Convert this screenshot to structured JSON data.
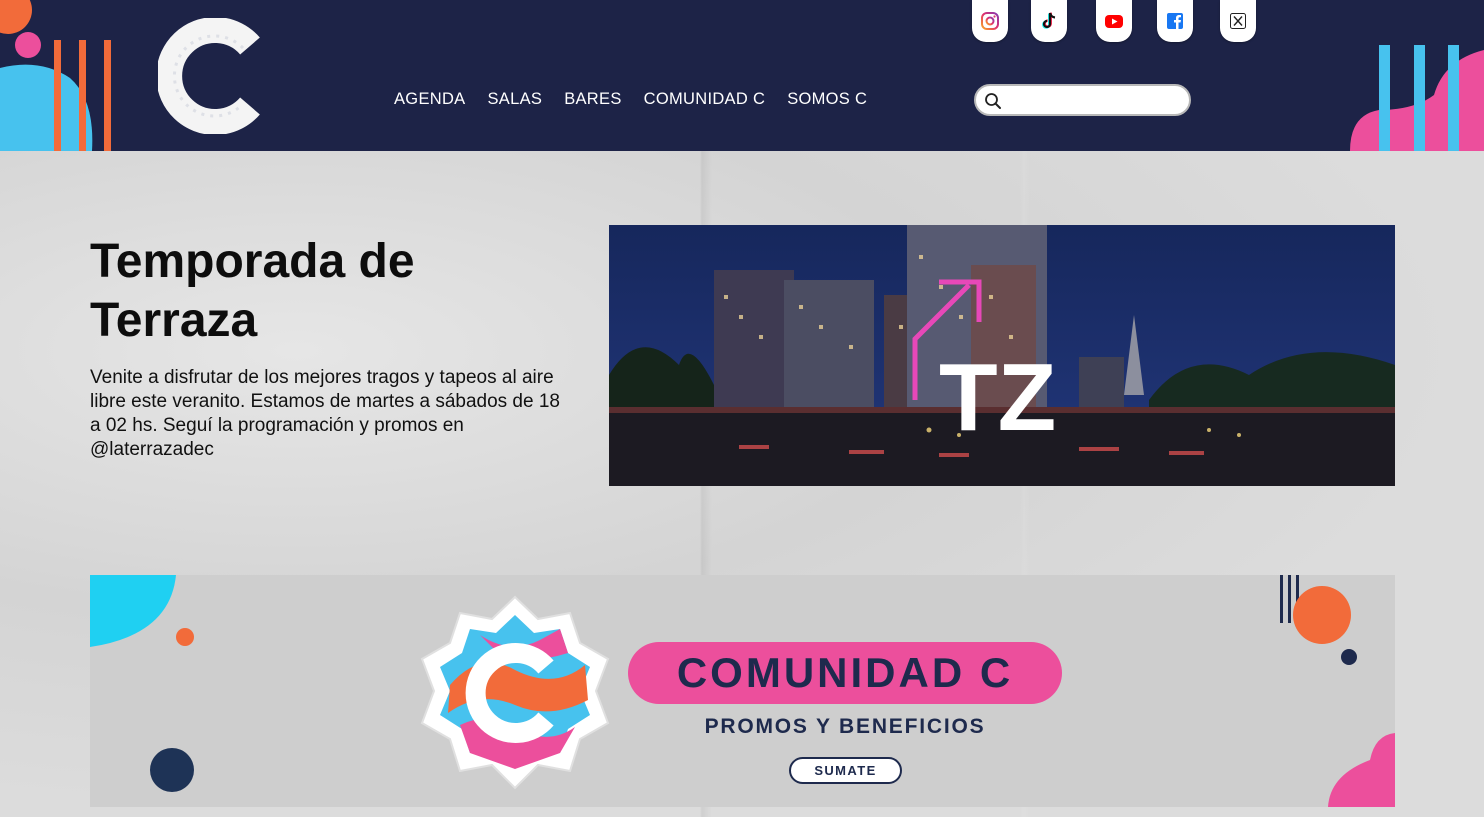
{
  "header": {
    "logo_letter": "C",
    "nav": [
      "AGENDA",
      "SALAS",
      "BARES",
      "COMUNIDAD C",
      "SOMOS C"
    ],
    "social": [
      "instagram-icon",
      "tiktok-icon",
      "youtube-icon",
      "facebook-icon",
      "x-icon"
    ],
    "search": {
      "placeholder": "",
      "value": ""
    }
  },
  "hero": {
    "title": "Temporada de Terraza",
    "text": "Venite a disfrutar de los mejores tragos y tapeos al aire libre este veranito. Estamos de martes a sábados de 18 a 02 hs.  Seguí la programación y promos en @laterrazadec",
    "image_mark": "TZ"
  },
  "banner": {
    "badge_letter": "C",
    "title": "COMUNIDAD C",
    "subtitle": "PROMOS Y BENEFICIOS",
    "button": "SUMATE"
  },
  "colors": {
    "header_bg": "#1d2347",
    "pink": "#ec4f9c",
    "orange": "#f26b3a",
    "cyan": "#47c2ee",
    "navy": "#1e2a4d"
  }
}
